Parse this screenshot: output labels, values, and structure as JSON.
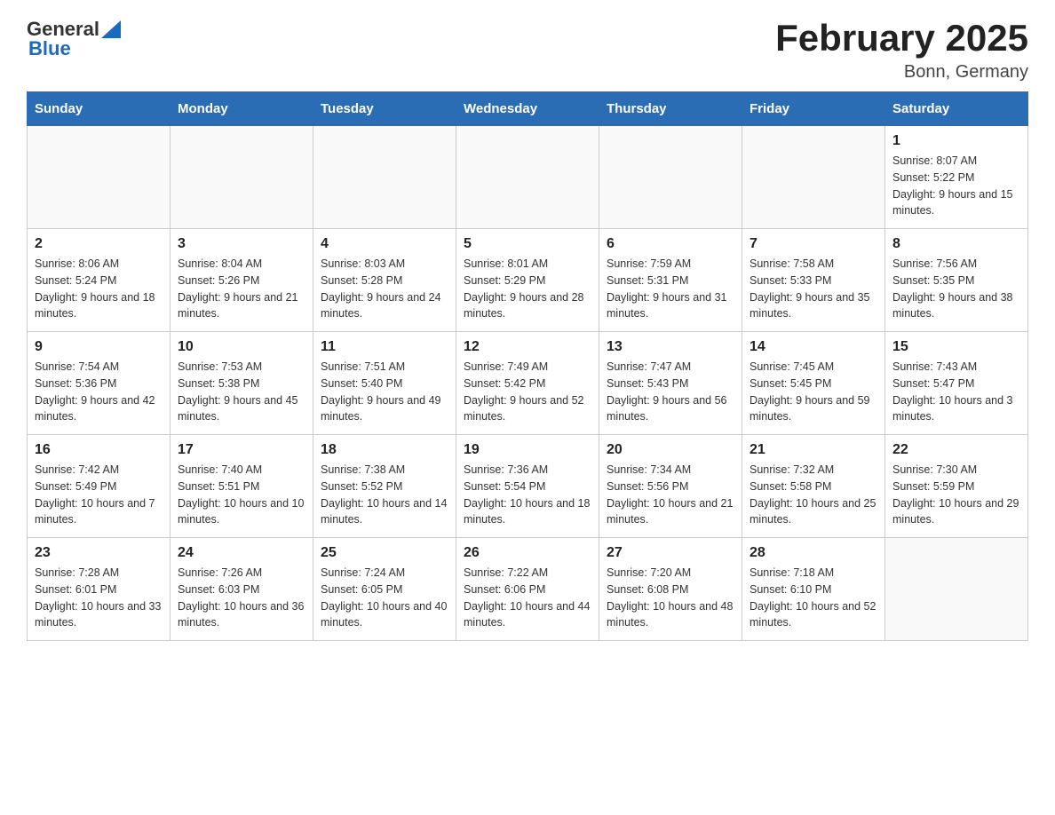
{
  "header": {
    "logo": {
      "text_general": "General",
      "text_blue": "Blue",
      "triangle": "▲"
    },
    "title": "February 2025",
    "subtitle": "Bonn, Germany"
  },
  "weekdays": [
    "Sunday",
    "Monday",
    "Tuesday",
    "Wednesday",
    "Thursday",
    "Friday",
    "Saturday"
  ],
  "weeks": [
    {
      "days": [
        {
          "number": "",
          "info": ""
        },
        {
          "number": "",
          "info": ""
        },
        {
          "number": "",
          "info": ""
        },
        {
          "number": "",
          "info": ""
        },
        {
          "number": "",
          "info": ""
        },
        {
          "number": "",
          "info": ""
        },
        {
          "number": "1",
          "info": "Sunrise: 8:07 AM\nSunset: 5:22 PM\nDaylight: 9 hours and 15 minutes."
        }
      ]
    },
    {
      "days": [
        {
          "number": "2",
          "info": "Sunrise: 8:06 AM\nSunset: 5:24 PM\nDaylight: 9 hours and 18 minutes."
        },
        {
          "number": "3",
          "info": "Sunrise: 8:04 AM\nSunset: 5:26 PM\nDaylight: 9 hours and 21 minutes."
        },
        {
          "number": "4",
          "info": "Sunrise: 8:03 AM\nSunset: 5:28 PM\nDaylight: 9 hours and 24 minutes."
        },
        {
          "number": "5",
          "info": "Sunrise: 8:01 AM\nSunset: 5:29 PM\nDaylight: 9 hours and 28 minutes."
        },
        {
          "number": "6",
          "info": "Sunrise: 7:59 AM\nSunset: 5:31 PM\nDaylight: 9 hours and 31 minutes."
        },
        {
          "number": "7",
          "info": "Sunrise: 7:58 AM\nSunset: 5:33 PM\nDaylight: 9 hours and 35 minutes."
        },
        {
          "number": "8",
          "info": "Sunrise: 7:56 AM\nSunset: 5:35 PM\nDaylight: 9 hours and 38 minutes."
        }
      ]
    },
    {
      "days": [
        {
          "number": "9",
          "info": "Sunrise: 7:54 AM\nSunset: 5:36 PM\nDaylight: 9 hours and 42 minutes."
        },
        {
          "number": "10",
          "info": "Sunrise: 7:53 AM\nSunset: 5:38 PM\nDaylight: 9 hours and 45 minutes."
        },
        {
          "number": "11",
          "info": "Sunrise: 7:51 AM\nSunset: 5:40 PM\nDaylight: 9 hours and 49 minutes."
        },
        {
          "number": "12",
          "info": "Sunrise: 7:49 AM\nSunset: 5:42 PM\nDaylight: 9 hours and 52 minutes."
        },
        {
          "number": "13",
          "info": "Sunrise: 7:47 AM\nSunset: 5:43 PM\nDaylight: 9 hours and 56 minutes."
        },
        {
          "number": "14",
          "info": "Sunrise: 7:45 AM\nSunset: 5:45 PM\nDaylight: 9 hours and 59 minutes."
        },
        {
          "number": "15",
          "info": "Sunrise: 7:43 AM\nSunset: 5:47 PM\nDaylight: 10 hours and 3 minutes."
        }
      ]
    },
    {
      "days": [
        {
          "number": "16",
          "info": "Sunrise: 7:42 AM\nSunset: 5:49 PM\nDaylight: 10 hours and 7 minutes."
        },
        {
          "number": "17",
          "info": "Sunrise: 7:40 AM\nSunset: 5:51 PM\nDaylight: 10 hours and 10 minutes."
        },
        {
          "number": "18",
          "info": "Sunrise: 7:38 AM\nSunset: 5:52 PM\nDaylight: 10 hours and 14 minutes."
        },
        {
          "number": "19",
          "info": "Sunrise: 7:36 AM\nSunset: 5:54 PM\nDaylight: 10 hours and 18 minutes."
        },
        {
          "number": "20",
          "info": "Sunrise: 7:34 AM\nSunset: 5:56 PM\nDaylight: 10 hours and 21 minutes."
        },
        {
          "number": "21",
          "info": "Sunrise: 7:32 AM\nSunset: 5:58 PM\nDaylight: 10 hours and 25 minutes."
        },
        {
          "number": "22",
          "info": "Sunrise: 7:30 AM\nSunset: 5:59 PM\nDaylight: 10 hours and 29 minutes."
        }
      ]
    },
    {
      "days": [
        {
          "number": "23",
          "info": "Sunrise: 7:28 AM\nSunset: 6:01 PM\nDaylight: 10 hours and 33 minutes."
        },
        {
          "number": "24",
          "info": "Sunrise: 7:26 AM\nSunset: 6:03 PM\nDaylight: 10 hours and 36 minutes."
        },
        {
          "number": "25",
          "info": "Sunrise: 7:24 AM\nSunset: 6:05 PM\nDaylight: 10 hours and 40 minutes."
        },
        {
          "number": "26",
          "info": "Sunrise: 7:22 AM\nSunset: 6:06 PM\nDaylight: 10 hours and 44 minutes."
        },
        {
          "number": "27",
          "info": "Sunrise: 7:20 AM\nSunset: 6:08 PM\nDaylight: 10 hours and 48 minutes."
        },
        {
          "number": "28",
          "info": "Sunrise: 7:18 AM\nSunset: 6:10 PM\nDaylight: 10 hours and 52 minutes."
        },
        {
          "number": "",
          "info": ""
        }
      ]
    }
  ]
}
